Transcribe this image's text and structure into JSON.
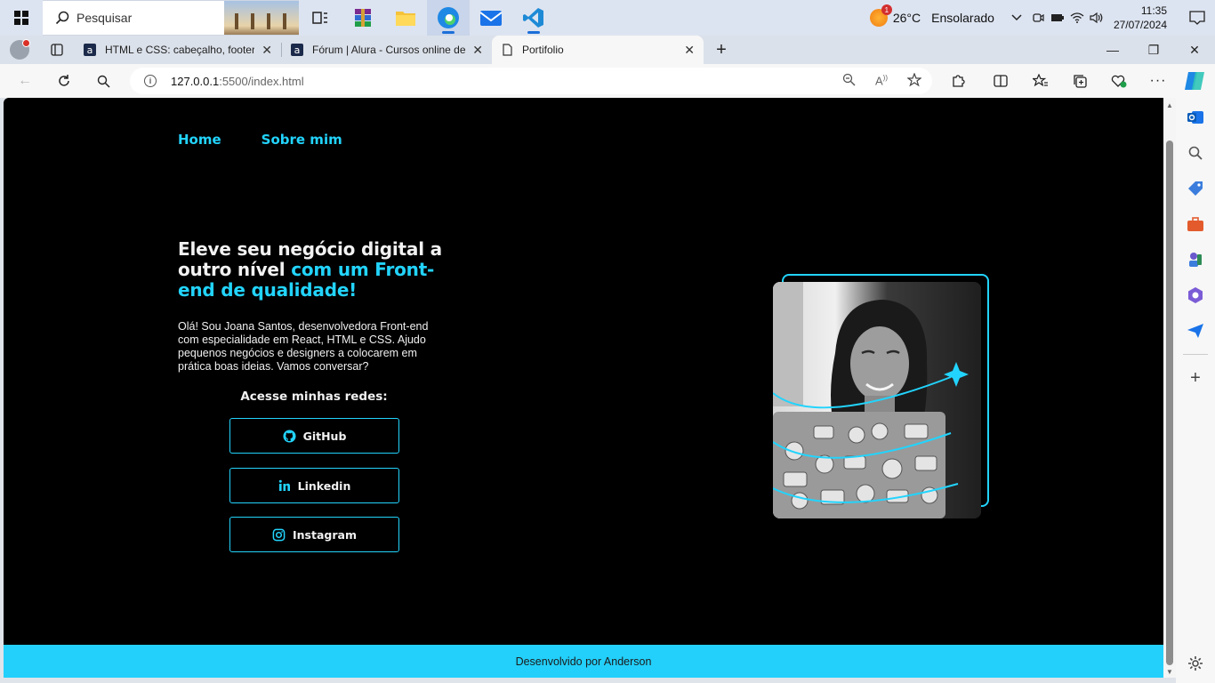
{
  "taskbar": {
    "search_placeholder": "Pesquisar",
    "weather_temp": "26°C",
    "weather_desc": "Ensolarado",
    "weather_badge": "1",
    "time": "11:35",
    "date": "27/07/2024"
  },
  "browser": {
    "tabs": [
      {
        "title": "HTML e CSS: cabeçalho, footer e"
      },
      {
        "title": "Fórum | Alura - Cursos online de"
      },
      {
        "title": "Portifolio"
      }
    ],
    "url_host": "127.0.0.1",
    "url_path": ":5500/index.html"
  },
  "site": {
    "nav": {
      "home": "Home",
      "about": "Sobre mim"
    },
    "hero": {
      "title_plain": "Eleve seu negócio digital a outro nível ",
      "title_accent": "com um Front-end de qualidade!",
      "description": "Olá! Sou Joana Santos, desenvolvedora Front-end com especialidade em React, HTML e CSS. Ajudo pequenos negócios e designers a colocarem em prática boas ideias. Vamos conversar?"
    },
    "social": {
      "title": "Acesse minhas redes:",
      "github": "GitHub",
      "linkedin": "Linkedin",
      "instagram": "Instagram"
    },
    "footer": "Desenvolvido por Anderson",
    "accent_color": "#22d4fd"
  }
}
